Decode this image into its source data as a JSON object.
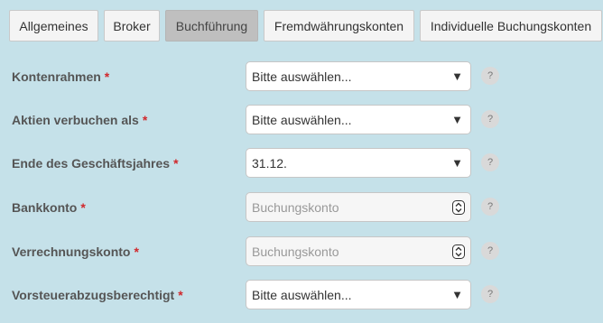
{
  "tabs": [
    {
      "label": "Allgemeines",
      "active": false
    },
    {
      "label": "Broker",
      "active": false
    },
    {
      "label": "Buchführung",
      "active": true
    },
    {
      "label": "Fremdwährungskonten",
      "active": false
    },
    {
      "label": "Individuelle Buchungskonten",
      "active": false
    }
  ],
  "required_marker": "*",
  "help_symbol": "?",
  "fields": [
    {
      "label": "Kontenrahmen",
      "type": "select",
      "value": "Bitte auswählen..."
    },
    {
      "label": "Aktien verbuchen als",
      "type": "select",
      "value": "Bitte auswählen..."
    },
    {
      "label": "Ende des Geschäftsjahres",
      "type": "select",
      "value": "31.12."
    },
    {
      "label": "Bankkonto",
      "type": "number",
      "value": "",
      "placeholder": "Buchungskonto"
    },
    {
      "label": "Verrechnungskonto",
      "type": "number",
      "value": "",
      "placeholder": "Buchungskonto"
    },
    {
      "label": "Vorsteuerabzugsberechtigt",
      "type": "select",
      "value": "Bitte auswählen..."
    }
  ],
  "icons": {
    "dropdown": "dropdown-arrow-icon",
    "spinner": "spinner-icon",
    "help": "help-icon"
  },
  "colors": {
    "background": "#c5e1e9",
    "required": "#d0282c",
    "active_tab": "#bfbfbf"
  }
}
